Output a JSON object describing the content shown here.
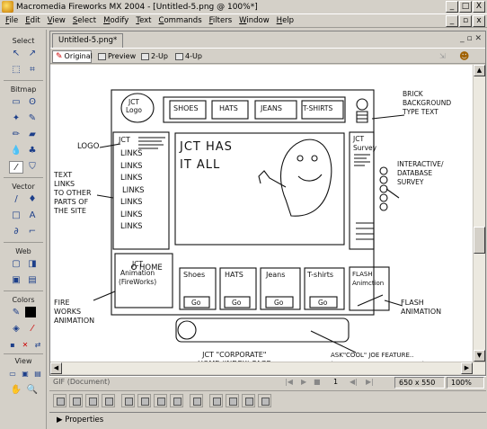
{
  "window": {
    "title": "Macromedia Fireworks MX 2004 - [Untitled-5.png @ 100%*]",
    "controls": [
      "_",
      "□",
      "X"
    ]
  },
  "menu": [
    "File",
    "Edit",
    "View",
    "Select",
    "Modify",
    "Text",
    "Commands",
    "Filters",
    "Window",
    "Help"
  ],
  "tools": {
    "sections": [
      "Select",
      "Bitmap",
      "Vector",
      "Web",
      "Colors",
      "View"
    ]
  },
  "document": {
    "tab": "Untitled-5.png*",
    "tab_controls": "_ ▫ ✕",
    "view_modes": [
      "Original",
      "Preview",
      "2-Up",
      "4-Up"
    ]
  },
  "sketch": {
    "logo_label": "LOGO",
    "jct_logo": "JCT\nLogo",
    "nav_tabs": [
      "SHOES",
      "HATS",
      "JEANS",
      "T-SHIRTS"
    ],
    "brick_note": "BRICK\nBACKGROUND\nTYPE TEXT",
    "text_links_note": "TEXT\nLINKS\nTO OTHER\nPARTS OF\nTHE SITE",
    "sidebar_title": "JCT",
    "links": [
      "LINKS",
      "LINKS",
      "LINKS",
      "LINKS",
      "LINKS",
      "LINKS",
      "LINKS"
    ],
    "home_link": "HOME",
    "headline": "JCT HAS\nIT ALL",
    "survey_title": "JCT\nSurvey",
    "survey_note": "INTERACTIVE/\nDATABASE\nSURVEY",
    "products": [
      {
        "name": "Shoes",
        "button": "Go"
      },
      {
        "name": "HATS",
        "button": "Go"
      },
      {
        "name": "Jeans",
        "button": "Go"
      },
      {
        "name": "T-shirts",
        "button": "Go"
      }
    ],
    "fireworks_note": "FIRE\nWORKS\nANIMATION",
    "fireworks_box": "JCT\nAnimation\n(FireWorks)",
    "flash_note": "FLASH\nANIMATION",
    "flash_box": "FLASH\nAnimction",
    "home_page_note": "JCT \"CORPORATE\"\nHOME (INDEX) PAGE",
    "ask_note": "ASK\"COOL\" JOE FEATURE..\n(LIFE A \"ASK JEEVES\" THAN...)"
  },
  "status": {
    "left": "GIF (Document)",
    "page": "1",
    "dimensions": "650 x 550",
    "zoom": "100%"
  },
  "panels": {
    "properties": "Properties"
  }
}
